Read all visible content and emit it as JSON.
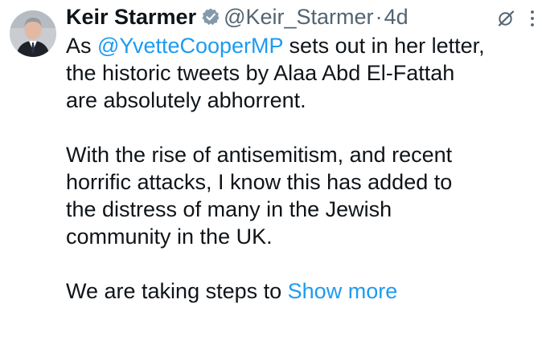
{
  "author": {
    "name": "Keir Starmer",
    "handle": "@Keir_Starmer",
    "separator": "·",
    "time": "4d"
  },
  "icons": {
    "avatar": "profile-photo",
    "verified": "verified-badge-icon",
    "grok": "grok-icon",
    "more": "more-vertical-icon"
  },
  "colors": {
    "link": "#1d9bf0",
    "secondary_text": "#536471",
    "verified_badge": "#829aab"
  },
  "tweet": {
    "p1": {
      "l1_pre": "As ",
      "l1_mention": "@YvetteCooperMP",
      "l1_post": " sets out in her letter,",
      "l2": "the historic tweets by Alaa Abd El-Fattah",
      "l3": "are absolutely abhorrent."
    },
    "p2": {
      "l1": "With the rise of antisemitism, and recent",
      "l2": "horrific attacks, I know this has added to",
      "l3": "the distress of many in the Jewish",
      "l4": "community in the UK."
    },
    "p3": {
      "l1_pre": "We are taking steps to ",
      "show_more": "Show more"
    }
  }
}
